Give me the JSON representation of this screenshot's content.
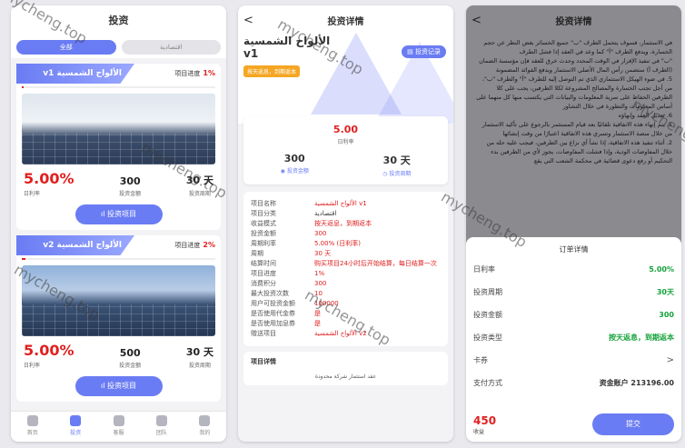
{
  "watermark": "mycheng.top",
  "invest_page": {
    "title": "投资",
    "filters": [
      "全部",
      "اقتصادية"
    ],
    "products": [
      {
        "name": "الألواح الشمسية v1",
        "progress_label": "项目进度",
        "progress_value": "1%",
        "progress_fraction": 0.01,
        "daily_rate": "5.00%",
        "daily_rate_label": "日利率",
        "amount": "300",
        "amount_label": "投资金额",
        "period": "30 天",
        "period_label": "投资周期",
        "button_label": "投资项目"
      },
      {
        "name": "الألواح الشمسية v2",
        "progress_label": "项目进度",
        "progress_value": "2%",
        "progress_fraction": 0.02,
        "daily_rate": "5.00%",
        "daily_rate_label": "日利率",
        "amount": "500",
        "amount_label": "投资金额",
        "period": "30 天",
        "period_label": "投资周期",
        "button_label": "投资项目"
      }
    ],
    "tabbar": [
      {
        "label": "首页",
        "icon": "home-icon"
      },
      {
        "label": "投资",
        "icon": "invest-icon",
        "active": true
      },
      {
        "label": "客服",
        "icon": "chat-icon"
      },
      {
        "label": "团队",
        "icon": "team-icon"
      },
      {
        "label": "我的",
        "icon": "user-icon"
      }
    ]
  },
  "detail_page": {
    "title": "投资详情",
    "back": "<",
    "product_name": "الألواح الشمسية v1",
    "record_button": "投资记录",
    "badge": "按天返息，到期返本",
    "summary": {
      "rate": "5.00",
      "rate_label": "日利率",
      "amount": "300",
      "amount_label": "投资金额",
      "period": "30 天",
      "period_label": "投资周期"
    },
    "rows": [
      {
        "k": "项目名称",
        "v": "الألواح الشمسية v1",
        "red": true
      },
      {
        "k": "项目分类",
        "v": "اقتصادية",
        "red": false
      },
      {
        "k": "收益模式",
        "v": "按天返息，到期返本",
        "red": true
      },
      {
        "k": "投资金额",
        "v": "300",
        "red": true
      },
      {
        "k": "周期利率",
        "v": "5.00% (日利率)",
        "red": true
      },
      {
        "k": "周期",
        "v": "30 天",
        "red": true
      },
      {
        "k": "结算时间",
        "v": "购买项目24小时后开始结算，每日结算一次",
        "red": true
      },
      {
        "k": "项目进度",
        "v": "1%",
        "red": true
      },
      {
        "k": "消费积分",
        "v": "300",
        "red": true
      },
      {
        "k": "最大投资次数",
        "v": "10",
        "red": true
      },
      {
        "k": "用户可投资金额",
        "v": "100000",
        "red": true
      },
      {
        "k": "是否使用代金券",
        "v": "是",
        "red": true
      },
      {
        "k": "是否使用加息券",
        "v": "是",
        "red": true
      },
      {
        "k": "赠送项目",
        "v": "الألواح الشمسية v2",
        "red": true
      }
    ],
    "more_title": "项目详情",
    "more_text": "عقد استثمار شركة محدودة"
  },
  "order_page": {
    "title": "投资详情",
    "back": "<",
    "body_text": [
      "في الاستثمار، فسوف يتحمل الطرف \"ب\" جميع الخسائر بغض النظر عن حجم الخسارة، ويدفع الطرف \"أ\" كما وعد في العقد إذا فشل الطرف",
      "\"ب\" في تنفيذ الإقرار في الوقت المحدد وحدث خرق للعقد فإن مؤسسة الضمان (الطرف أ) ستضمن رأس المال الأصلي الاستثمار ويدفع الفوائد المضمونة",
      "5. في ضوء الهيكل الاستثماري الذي تم التوصل إليه للطرف \"أ\" والطرف \"ب\"، من أجل تجنب الخسارة والمصالح المشروعة لكلا الطرفين، يجب على كلا الطرفين الحفاظ على سرية المعلومات والبيانات التي يكتسب منها كل منهما على أساس المعلومات والتطورة في خلال التشاور",
      "6. تعديل العقد وإنهاؤه",
      "1. يتم إنهاء هذه الاتفاقية تلقائيًا بعد قيام المستثمر بالرجوع على تأكيد الاستثمار من خلال منصة الاستثمار وتسري هذه الاتفاقية اعتبارًا من وقت إنشائها",
      "2. أثناء تنفيذ هذه الاتفاقية، إذا نشأ أي نزاع بين الطرفين، فيجب عليه حله من خلال المفاوضات الودية، وإذا فشلت المفاوضات، يجوز لأي من الطرفين بدء التحكيم أو رفع دعوى قضائية في محكمة الشعب التي يقع"
    ],
    "sheet_title": "订单详情",
    "rows": [
      {
        "k": "日利率",
        "v": "5.00%",
        "style": "g"
      },
      {
        "k": "投资周期",
        "v": "30天",
        "style": "g"
      },
      {
        "k": "投资金额",
        "v": "300",
        "style": "g"
      },
      {
        "k": "投资类型",
        "v": "按天返息，到期返本",
        "style": "g"
      },
      {
        "k": "卡券",
        "v": ">",
        "style": "chev"
      },
      {
        "k": "支付方式",
        "v": "资金账户 213196.00",
        "style": "b"
      }
    ],
    "total": "450",
    "total_label": "收益",
    "submit": "提交"
  }
}
